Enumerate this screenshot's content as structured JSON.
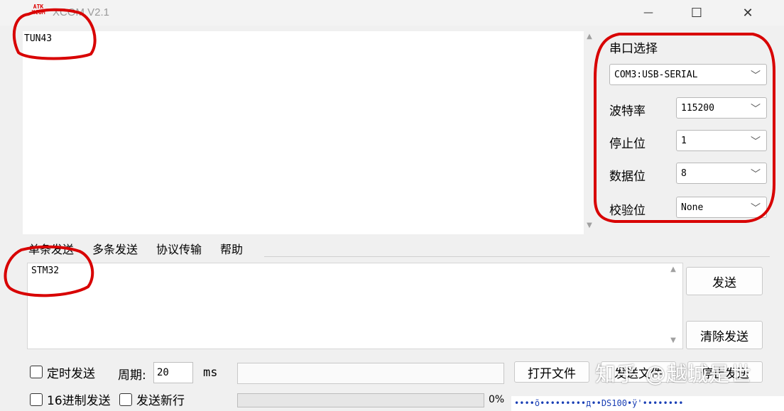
{
  "window": {
    "title": "XCOM V2.1",
    "icon_text": "ATK XCOM",
    "icon_name": "xcom-logo",
    "minimize_icon": "—",
    "maximize_icon": "☐",
    "close_icon": "✕"
  },
  "receive": {
    "text": "TUN43"
  },
  "serial_panel": {
    "port_select_label": "串口选择",
    "port_value": "COM3:USB-SERIAL",
    "baud_label": "波特率",
    "baud_value": "115200",
    "stop_bits_label": "停止位",
    "stop_bits_value": "1",
    "data_bits_label": "数据位",
    "data_bits_value": "8",
    "parity_label": "校验位",
    "parity_value": "None"
  },
  "tabs": [
    {
      "label": "单条发送"
    },
    {
      "label": "多条发送"
    },
    {
      "label": "协议传输"
    },
    {
      "label": "帮助"
    }
  ],
  "send": {
    "text": "STM32",
    "send_button": "发送",
    "clear_send_button": "清除发送"
  },
  "bottom": {
    "timed_send_label": "定时发送",
    "period_label": "周期:",
    "period_value": "20",
    "period_unit": "ms",
    "hex_send_label": "16进制发送",
    "send_newline_label": "发送新行",
    "progress_percent": "0%",
    "open_file_button": "打开文件",
    "send_file_button": "发送文件",
    "stop_send_button": "停止发送",
    "status_text": "••••õ•••••••••д••DS100•ÿ'••••••••"
  },
  "watermark": "知乎 @越城是世",
  "colors": {
    "annotation_red": "#d80000",
    "window_bg": "#f0f0f0",
    "text_area_bg": "#ffffff"
  }
}
